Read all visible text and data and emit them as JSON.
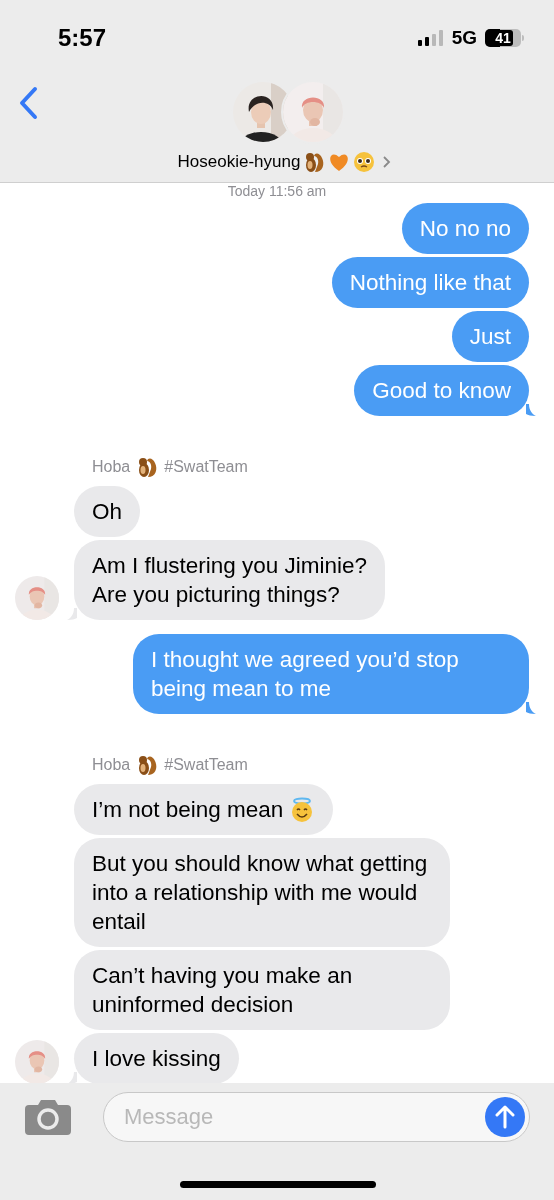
{
  "status_bar": {
    "time": "5:57",
    "network": "5G",
    "battery": "41"
  },
  "header": {
    "contact_name": "Hoseokie-hyung"
  },
  "timestamp": "Today 11:56 am",
  "items": [
    {
      "kind": "sent",
      "text": "No no no"
    },
    {
      "kind": "sent",
      "text": "Nothing like that"
    },
    {
      "kind": "sent",
      "text": "Just"
    },
    {
      "kind": "sent",
      "text": "Good to know"
    },
    {
      "kind": "sender_label",
      "name": "Hoba",
      "tag": "#SwatTeam"
    },
    {
      "kind": "received",
      "text": "Oh"
    },
    {
      "kind": "received",
      "text": "Am I flustering you Jiminie?\nAre you picturing things?"
    },
    {
      "kind": "sent",
      "text": "I thought we agreed you’d stop being mean to me"
    },
    {
      "kind": "sender_label",
      "name": "Hoba",
      "tag": "#SwatTeam"
    },
    {
      "kind": "received_with_icon",
      "text": "I’m not being mean"
    },
    {
      "kind": "received",
      "text": "But you should know what getting into a relationship with me would entail"
    },
    {
      "kind": "received",
      "text": "Can’t having you make an uninformed decision"
    },
    {
      "kind": "received",
      "text": "I love kissing"
    }
  ],
  "composer": {
    "placeholder": "Message"
  }
}
